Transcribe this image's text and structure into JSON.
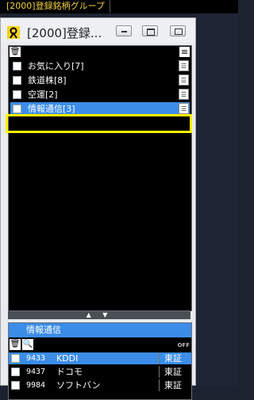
{
  "topbar": {
    "tab_label": "[2000]登録銘柄グループ"
  },
  "window": {
    "title": "[2000]登録...",
    "minimize_icon": "minimize-icon",
    "restore_icon": "restore-icon",
    "close_icon": "close-icon"
  },
  "groups": {
    "items": [
      {
        "label": "お気に入り[7]",
        "selected": false
      },
      {
        "label": "鉄道株[8]",
        "selected": false
      },
      {
        "label": "空運[2]",
        "selected": false
      },
      {
        "label": "情報通信[3]",
        "selected": true
      }
    ]
  },
  "splitter": {
    "label": "▲ ▼"
  },
  "detail": {
    "header": "情報通信",
    "off_label": "OFF",
    "stocks": [
      {
        "code": "9433",
        "name": "KDDI",
        "market": "東証",
        "selected": true
      },
      {
        "code": "9437",
        "name": "ドコモ",
        "market": "東証",
        "selected": false
      },
      {
        "code": "9984",
        "name": "ソフトバン",
        "market": "東証",
        "selected": false
      }
    ]
  },
  "colors": {
    "accent": "#3b8de8",
    "highlight": "#fff200",
    "tab_text": "#f3d23c"
  }
}
